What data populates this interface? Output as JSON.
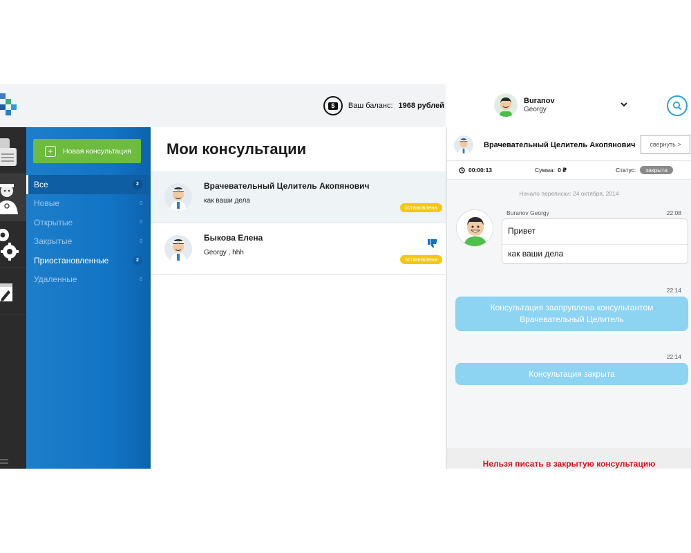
{
  "header": {
    "balance_label": "Ваш баланс:",
    "balance_value": "1968 рублей",
    "user_first": "Buranov",
    "user_last": "Georgy"
  },
  "sidebar": {
    "new_button": "Новая консультация",
    "filters": [
      {
        "label": "Все",
        "count": "2"
      },
      {
        "label": "Новые",
        "count": "0"
      },
      {
        "label": "Открытые",
        "count": "0"
      },
      {
        "label": "Закрытые",
        "count": "0"
      },
      {
        "label": "Приостановленные",
        "count": "2"
      },
      {
        "label": "Удаленные",
        "count": "0"
      }
    ]
  },
  "list": {
    "title": "Мои консультации",
    "items": [
      {
        "name": "Врачевательный Целитель Акопянович",
        "message": "как ваши дела",
        "badge": "остановлена"
      },
      {
        "name": "Быкова Елена",
        "message": "Georgy , hhh",
        "badge": "остановлена"
      }
    ]
  },
  "chat": {
    "title": "Врачевательный Целитель Акопянович",
    "collapse": "свернуть >",
    "timer": "00:00:13",
    "sum_label": "Сумма:",
    "sum_value": "0 ₽",
    "status_label": "Статус:",
    "status_value": "закрыта",
    "start": "Начало переписки: 24 октября, 2014",
    "message": {
      "author": "Buranov Georgy",
      "time": "22:08",
      "line1": "Привет",
      "line2": "как ваши дела"
    },
    "system": [
      {
        "time": "22:14",
        "line1": "Консультация заапрувлена консультантом",
        "line2": "Врачевательный Целитель"
      },
      {
        "time": "22:14",
        "text": "Консультация закрыта"
      }
    ],
    "warning": "Нельзя писать в закрытую консультацию"
  },
  "colors": {
    "brand_blue": "#1173c3",
    "accent_green": "#6dbb3f",
    "badge_yellow": "#f5c710",
    "system_bubble": "#8dd3f2",
    "warning_red": "#e0101a"
  },
  "icons": [
    "logo-icon",
    "wallet-icon",
    "chevron-down-icon",
    "search-icon",
    "chat-list-icon",
    "doctor-icon",
    "settings-icon",
    "edit-icon",
    "plus-icon",
    "clock-icon",
    "dislike-icon"
  ]
}
